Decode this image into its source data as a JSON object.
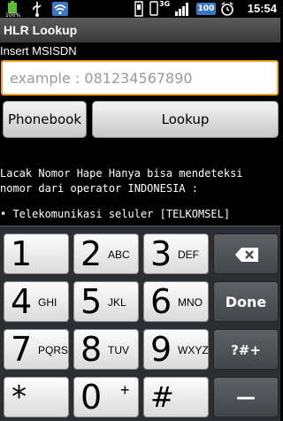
{
  "status_bar": {
    "time": "15:54",
    "network": "3G",
    "battery": "100",
    "icons": [
      "battery-100-icon",
      "usb-icon",
      "wifi-icon",
      "sd-card-icon",
      "phone-icon",
      "3g-signal-icon",
      "signal-bars-icon",
      "battery-icon",
      "alarm-icon"
    ]
  },
  "app": {
    "title": "HLR Lookup"
  },
  "form": {
    "label": "Insert MSISDN",
    "input_placeholder": "example : 081234567890",
    "input_value": "",
    "phonebook_label": "Phonebook",
    "lookup_label": "Lookup"
  },
  "info": {
    "line1": "Lacak Nomor Hape Hanya bisa mendeteksi",
    "line2": "nomor dari operator INDONESIA :",
    "bullet": "• Telekomunikasi seluler [TELKOMSEL]"
  },
  "keypad": {
    "keys": [
      {
        "num": "1",
        "letters": ""
      },
      {
        "num": "2",
        "letters": "ABC"
      },
      {
        "num": "3",
        "letters": "DEF"
      },
      {
        "num": "4",
        "letters": "GHI"
      },
      {
        "num": "5",
        "letters": "JKL"
      },
      {
        "num": "6",
        "letters": "MNO"
      },
      {
        "num": "7",
        "letters": "PQRS"
      },
      {
        "num": "8",
        "letters": "TUV"
      },
      {
        "num": "9",
        "letters": "WXYZ"
      },
      {
        "num": "*",
        "letters": ""
      },
      {
        "num": "0",
        "letters": "+"
      },
      {
        "num": "#",
        "letters": ""
      }
    ],
    "done_label": "Done",
    "symbols_label": "?#+",
    "space_label": "—",
    "backspace_icon": "backspace-icon"
  }
}
